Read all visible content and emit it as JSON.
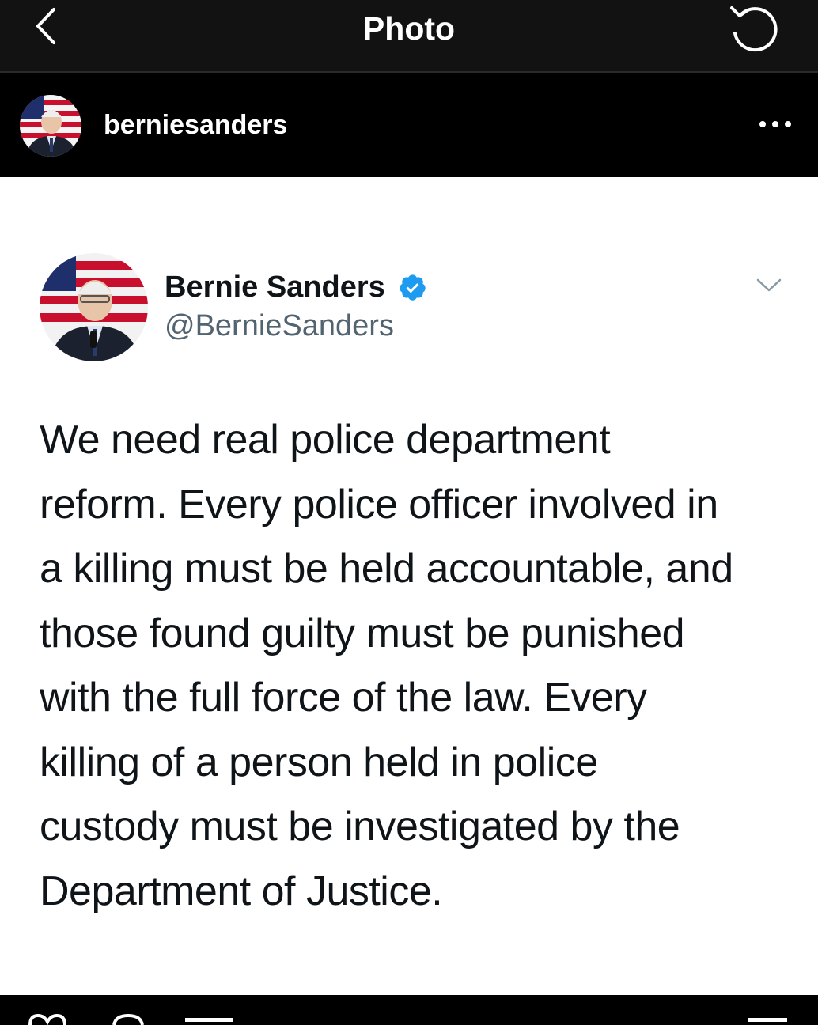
{
  "nav": {
    "title": "Photo",
    "back_icon": "chevron-left-icon",
    "refresh_icon": "rotate-icon"
  },
  "post": {
    "username": "berniesanders",
    "more_icon": "more-horizontal-icon"
  },
  "tweet": {
    "name": "Bernie Sanders",
    "handle": "@BernieSanders",
    "text": "We need real police department\nreform. Every police officer involved in\na killing must be held accountable, and\nthose found guilty must be punished\nwith the full force of the law.  Every\nkilling of a person held in police\ncustody must be investigated by the\nDepartment of Justice."
  },
  "colors": {
    "verified_blue": "#1d9bf0",
    "nav_bg": "#121212",
    "text_dark": "#0f1419",
    "handle_gray": "#536471"
  }
}
